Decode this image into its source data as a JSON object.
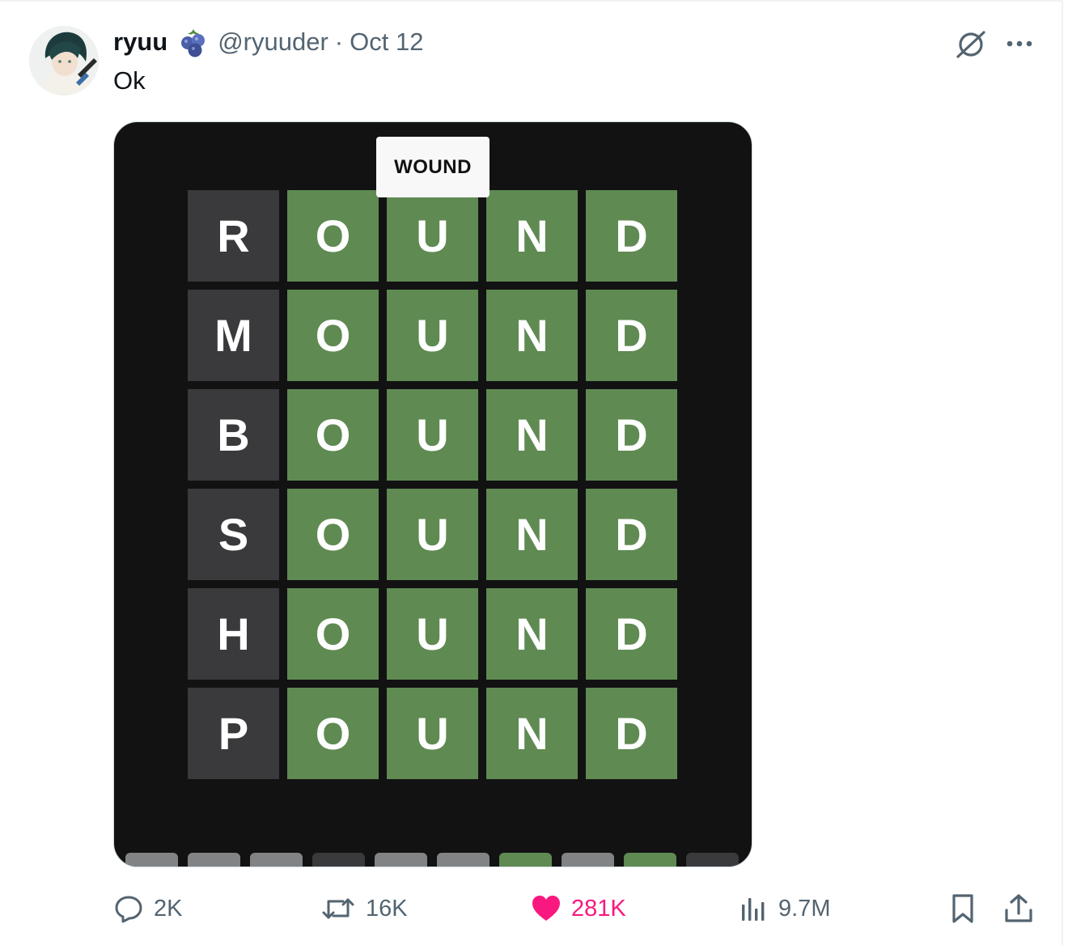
{
  "tweet": {
    "author": {
      "display_name": "ryuu",
      "handle": "@ryuuder",
      "badge_icon": "blueberry-icon"
    },
    "separator": "·",
    "date": "Oct 12",
    "text": "Ok",
    "top_actions": {
      "grok_icon": "grok-icon",
      "more_icon": "more-icon"
    }
  },
  "media": {
    "toast": "WOUND",
    "rows": [
      {
        "letters": [
          "R",
          "O",
          "U",
          "N",
          "D"
        ],
        "states": [
          "absent",
          "correct",
          "correct",
          "correct",
          "correct"
        ]
      },
      {
        "letters": [
          "M",
          "O",
          "U",
          "N",
          "D"
        ],
        "states": [
          "absent",
          "correct",
          "correct",
          "correct",
          "correct"
        ]
      },
      {
        "letters": [
          "B",
          "O",
          "U",
          "N",
          "D"
        ],
        "states": [
          "absent",
          "correct",
          "correct",
          "correct",
          "correct"
        ]
      },
      {
        "letters": [
          "S",
          "O",
          "U",
          "N",
          "D"
        ],
        "states": [
          "absent",
          "correct",
          "correct",
          "correct",
          "correct"
        ]
      },
      {
        "letters": [
          "H",
          "O",
          "U",
          "N",
          "D"
        ],
        "states": [
          "absent",
          "correct",
          "correct",
          "correct",
          "correct"
        ]
      },
      {
        "letters": [
          "P",
          "O",
          "U",
          "N",
          "D"
        ],
        "states": [
          "absent",
          "correct",
          "correct",
          "correct",
          "correct"
        ]
      }
    ],
    "keyboard_key_states": [
      "unused",
      "unused",
      "unused",
      "absent",
      "unused",
      "unused",
      "correct",
      "unused",
      "correct",
      "absent"
    ],
    "colors": {
      "background": "#121213",
      "absent": "#3a3a3c",
      "correct": "#5f8a52",
      "unused_key": "#818384"
    }
  },
  "actions": {
    "replies": "2K",
    "retweets": "16K",
    "likes": "281K",
    "views": "9.7M",
    "liked": true,
    "like_color": "#f91880"
  }
}
